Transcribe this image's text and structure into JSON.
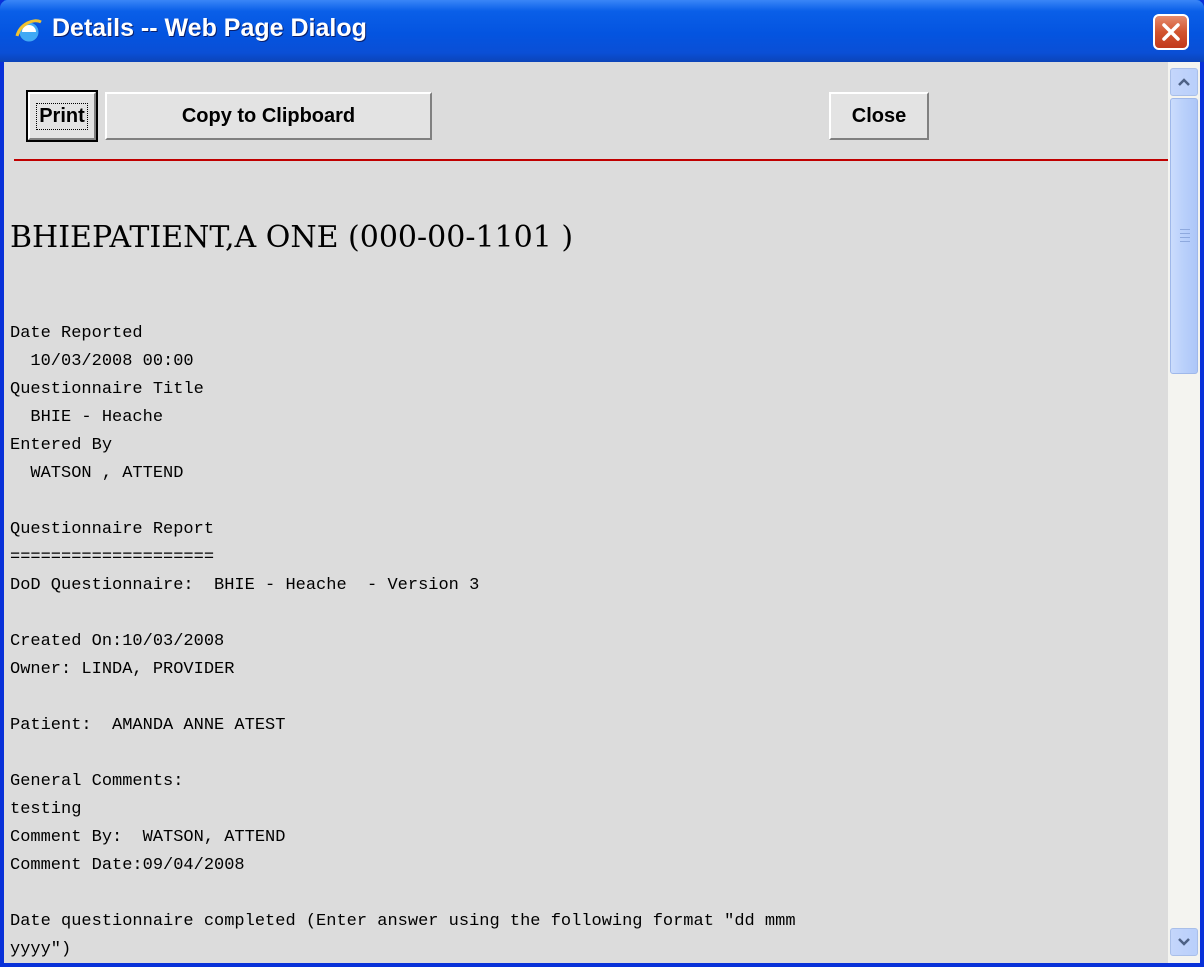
{
  "window": {
    "title": "Details -- Web Page Dialog",
    "title_icon": "ie-icon",
    "close_icon": "close-icon"
  },
  "toolbar": {
    "print_label": "Print",
    "copy_label": "Copy to Clipboard",
    "close_label": "Close"
  },
  "header": {
    "patient_line": "BHIEPATIENT,A ONE (000-00-1101 )"
  },
  "report_lines": [
    "Date Reported",
    "  10/03/2008 00:00",
    "Questionnaire Title",
    "  BHIE - Heache",
    "Entered By",
    "  WATSON , ATTEND",
    "",
    "Questionnaire Report",
    "====================",
    "DoD Questionnaire:  BHIE - Heache  - Version 3",
    "",
    "Created On:10/03/2008",
    "Owner: LINDA, PROVIDER",
    "",
    "Patient:  AMANDA ANNE ATEST",
    "",
    "General Comments:",
    "testing",
    "Comment By:  WATSON, ATTEND",
    "Comment Date:09/04/2008",
    "",
    "Date questionnaire completed (Enter answer using the following format \"dd mmm",
    "yyyy\")"
  ],
  "colors": {
    "title_bar": "#0a5fe8",
    "content_bg": "#dcdcdc",
    "rule": "#c00000"
  }
}
